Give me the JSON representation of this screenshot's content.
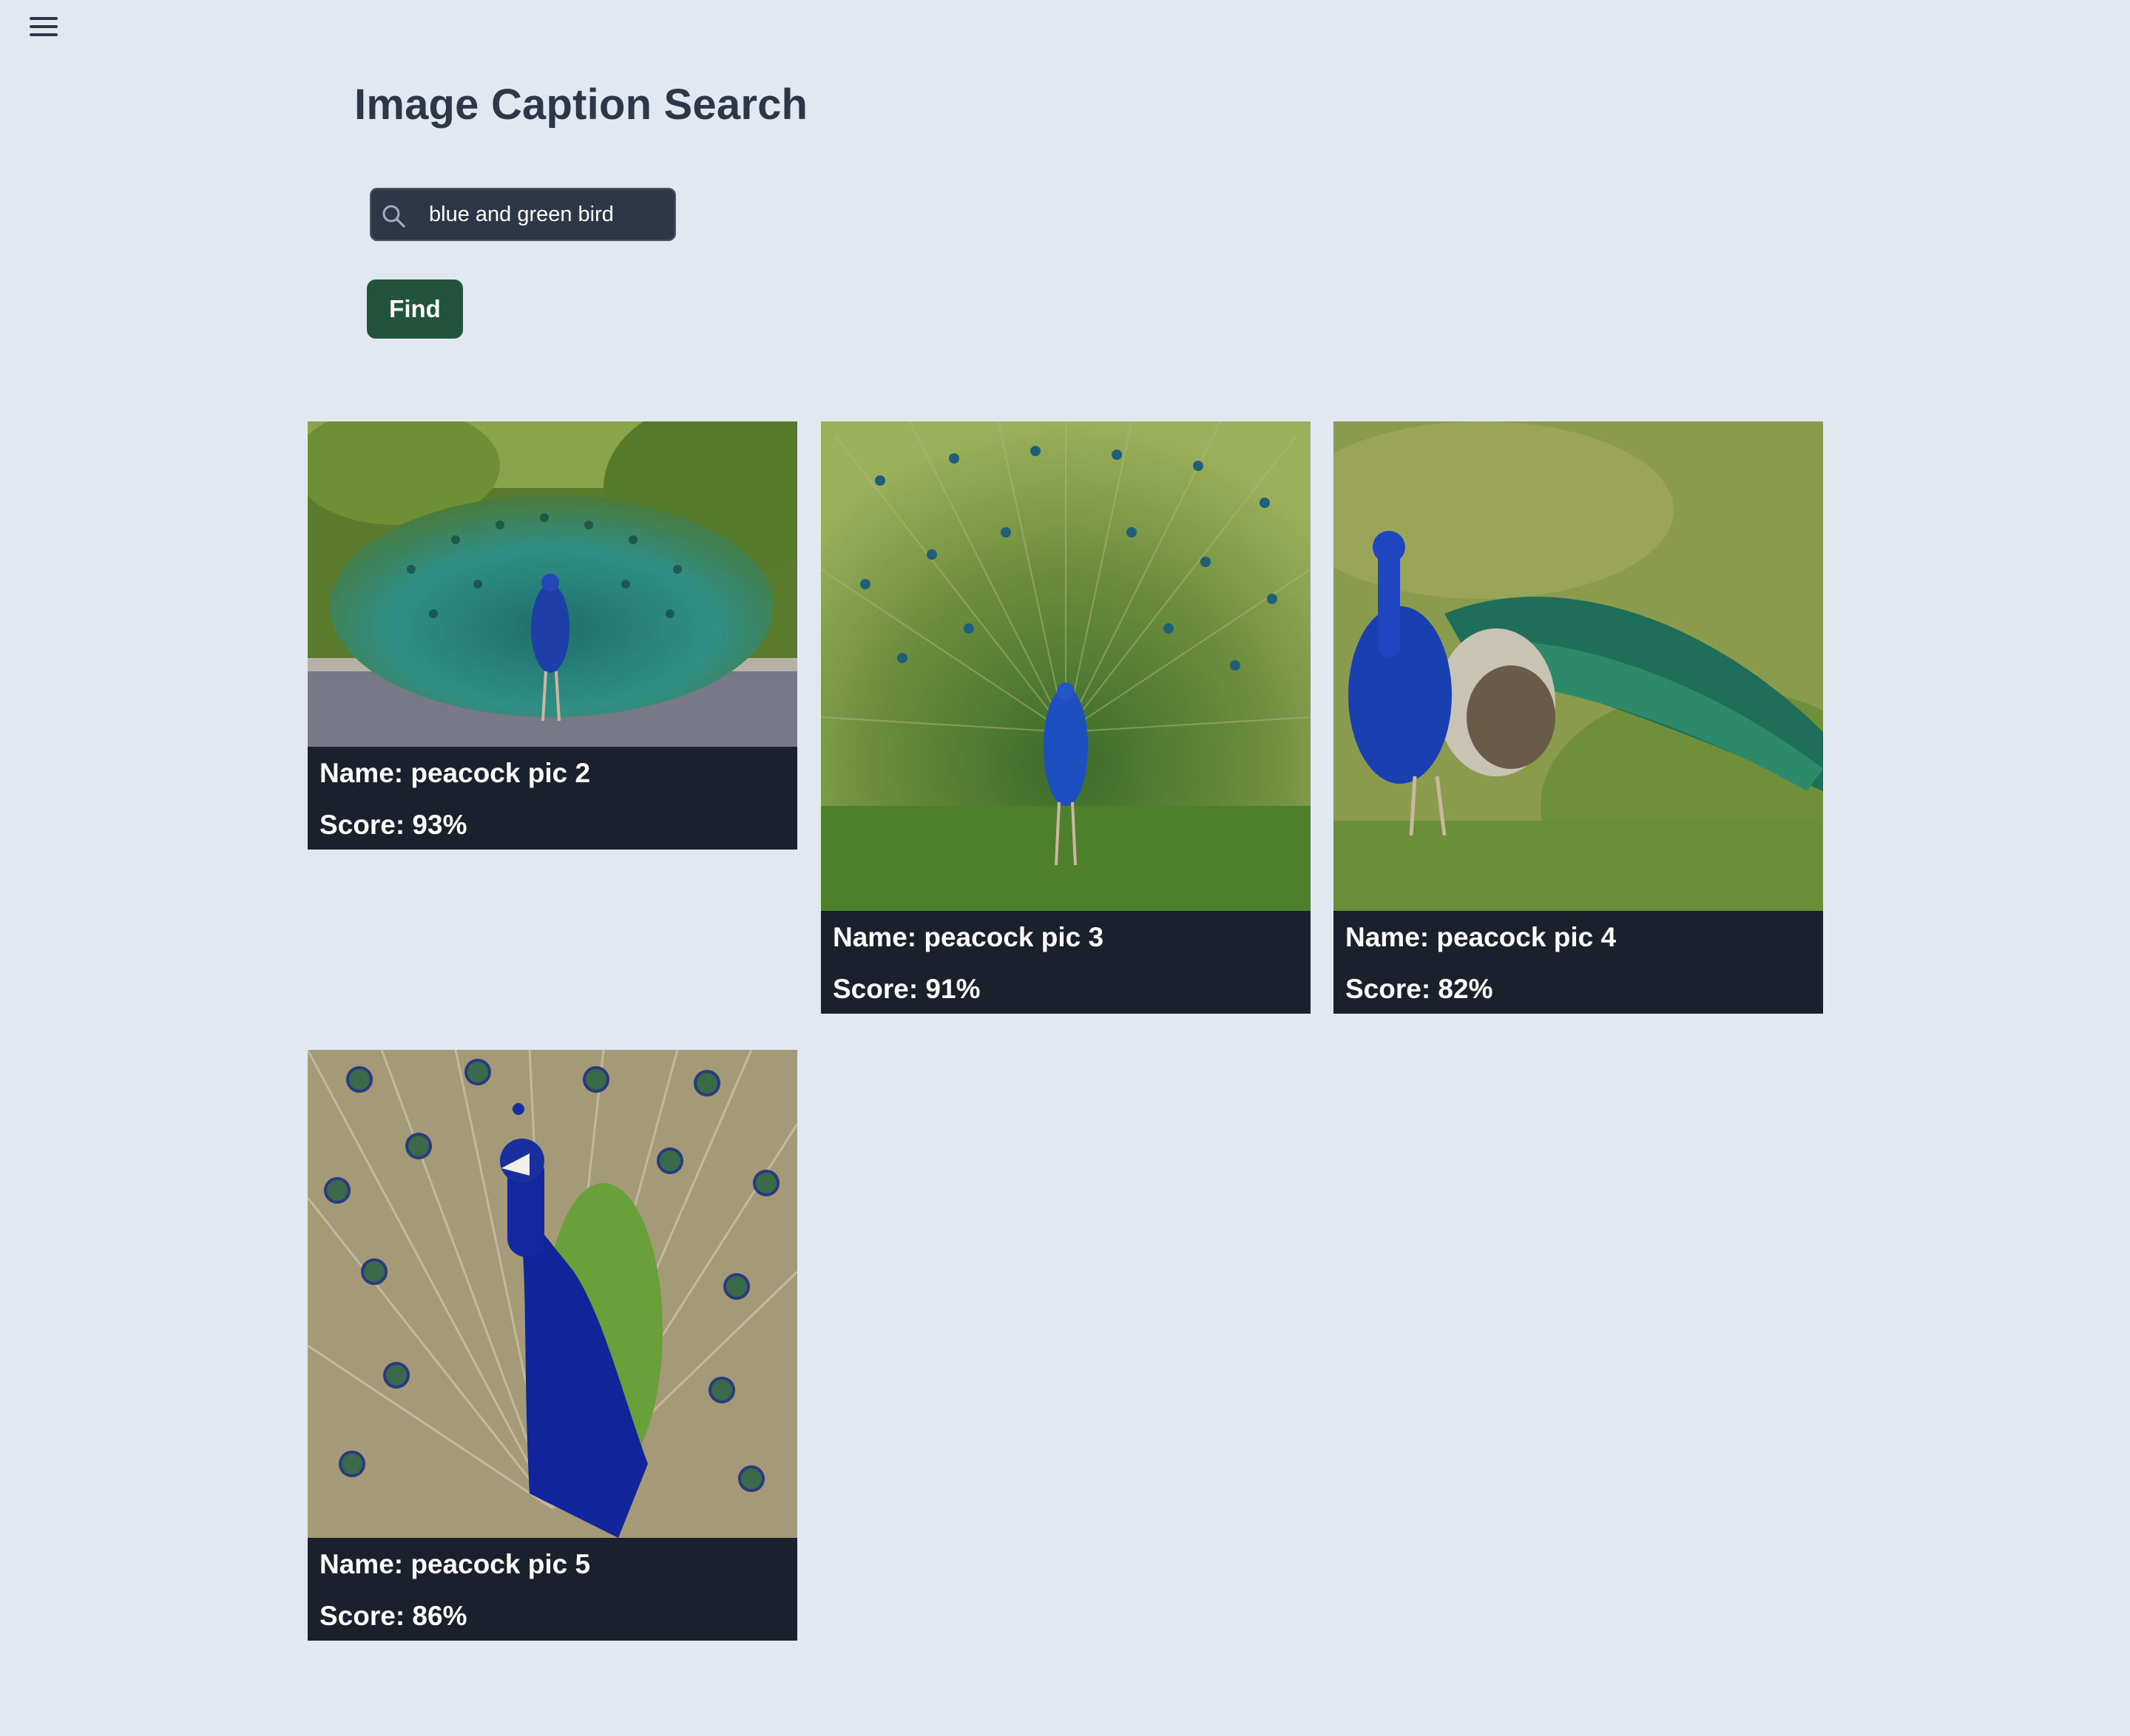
{
  "header": {
    "menu_icon": "hamburger-menu-icon",
    "title": "Image Caption Search"
  },
  "search": {
    "icon": "search-icon",
    "value": "blue and green bird",
    "find_label": "Find"
  },
  "results": [
    {
      "name": "Name: peacock pic 2",
      "score": "Score: 93%"
    },
    {
      "name": "Name: peacock pic 3",
      "score": "Score: 91%"
    },
    {
      "name": "Name: peacock pic 4",
      "score": "Score: 82%"
    },
    {
      "name": "Name: peacock pic 5",
      "score": "Score: 86%"
    }
  ],
  "colors": {
    "background": "#e2e8f0",
    "card": "#1a202c",
    "button": "#22543d",
    "input": "#2d3748"
  }
}
